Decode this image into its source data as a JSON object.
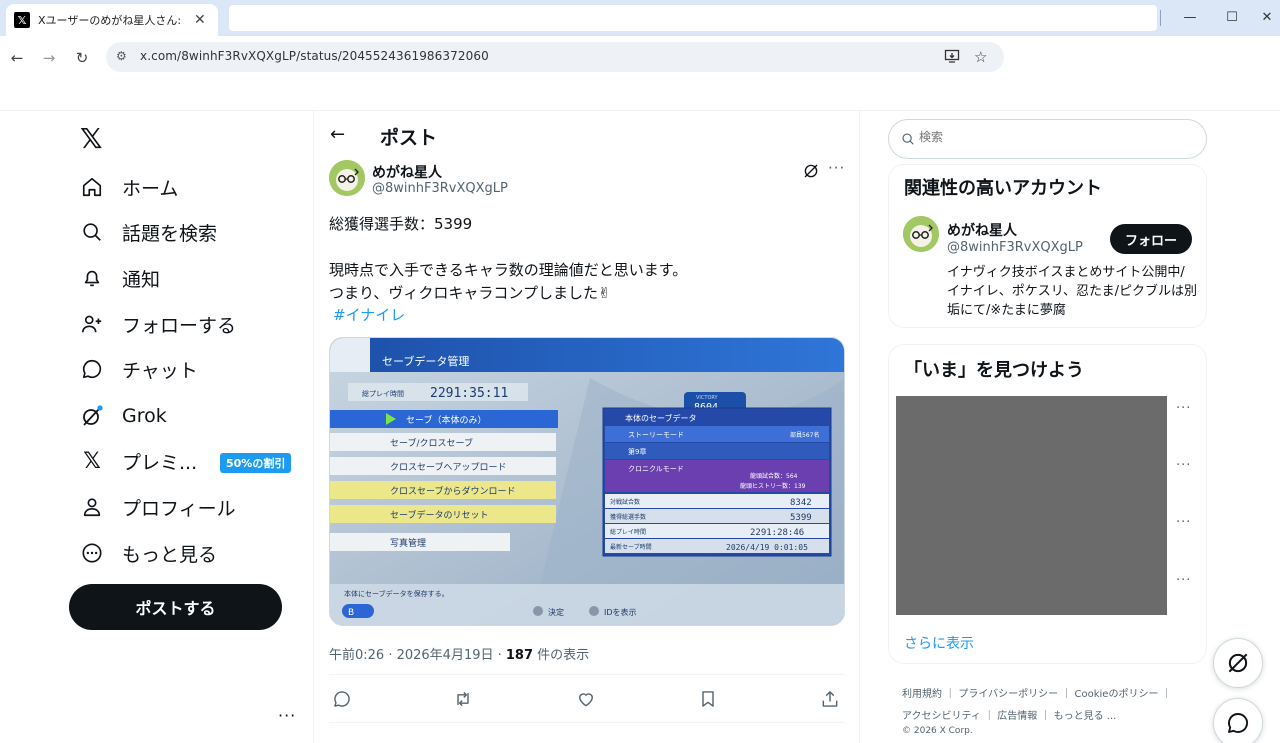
{
  "browser": {
    "tab_title": "Xユーザーのめがね星人さん:「総獲得",
    "url": "x.com/8winhF3RvXQXgLP/status/2045524361986372060"
  },
  "nav": {
    "items": [
      {
        "label": "ホーム",
        "icon": "home-icon"
      },
      {
        "label": "話題を検索",
        "icon": "search-icon"
      },
      {
        "label": "通知",
        "icon": "bell-icon"
      },
      {
        "label": "フォローする",
        "icon": "person-add-icon"
      },
      {
        "label": "チャット",
        "icon": "chat-icon"
      },
      {
        "label": "Grok",
        "icon": "grok-icon"
      },
      {
        "label": "プレミ...",
        "icon": "x-premium-icon"
      },
      {
        "label": "プロフィール",
        "icon": "person-icon"
      },
      {
        "label": "もっと見る",
        "icon": "more-circle-icon"
      }
    ],
    "premium_badge": "50%の割引",
    "post_button": "ポストする"
  },
  "post": {
    "header_title": "ポスト",
    "author_name": "めがね星人",
    "author_handle": "@8winhF3RvXQXgLP",
    "line1": "総獲得選手数：5399",
    "line2": "現時点で入手できるキャラ数の理論値だと思います。",
    "line3": "つまり、ヴィクロキャラコンプしました✌",
    "hashtag": "#イナイレ",
    "time": "午前0:26 · 2026年4月19日 · ",
    "views": "187",
    "views_suffix": " 件の表示"
  },
  "media": {
    "header": "セーブデータ管理",
    "playtime_label": "総プレイ時間",
    "playtime": "2291:35:11",
    "menu": [
      "セーブ（本体のみ）",
      "セーブ/クロスセーブ",
      "クロスセーブへアップロード",
      "クロスセーブからダウンロード",
      "セーブデータのリセット",
      "写真管理"
    ],
    "footer_hint": "本体にセーブデータを保存する。",
    "btn_b": "B",
    "btn_a": "決定",
    "btn_y": "IDを表示",
    "victory_label": "VICTORY",
    "victory_num": "8604",
    "panel_title": "本体のセーブデータ",
    "story_mode": "ストーリーモード",
    "story_count": "部員567名",
    "story_chapter": "第9章",
    "chronicle": "クロニクルモード",
    "chronicle_1": "龍頭試合数：564",
    "chronicle_2": "龍頭ヒストリー数：139",
    "stats": [
      {
        "label": "対戦試合数",
        "value": "8342"
      },
      {
        "label": "獲得総選手数",
        "value": "5399"
      },
      {
        "label": "総プレイ時間",
        "value": "2291:28:46"
      },
      {
        "label": "最新セーブ時間",
        "value": "2026/4/19 0:01:05"
      }
    ]
  },
  "sidebar": {
    "search_placeholder": "検索",
    "related_title": "関連性の高いアカウント",
    "related_name": "めがね星人",
    "related_handle": "@8winhF3RvXQXgLP",
    "follow_label": "フォロー",
    "related_bio": "イナヴィク技ボイスまとめサイト公開中/ イナイレ、ポケスリ、忍たま/ピクブルは別垢にて/※たまに夢腐",
    "trends_title": "「いま」を見つけよう",
    "show_more": "さらに表示",
    "footer_line1": "利用規約 ｜ プライバシーポリシー ｜ Cookieのポリシー ｜",
    "footer_line2": "アクセシビリティ ｜ 広告情報 ｜ もっと見る ...",
    "footer_line3": "© 2026 X Corp."
  }
}
